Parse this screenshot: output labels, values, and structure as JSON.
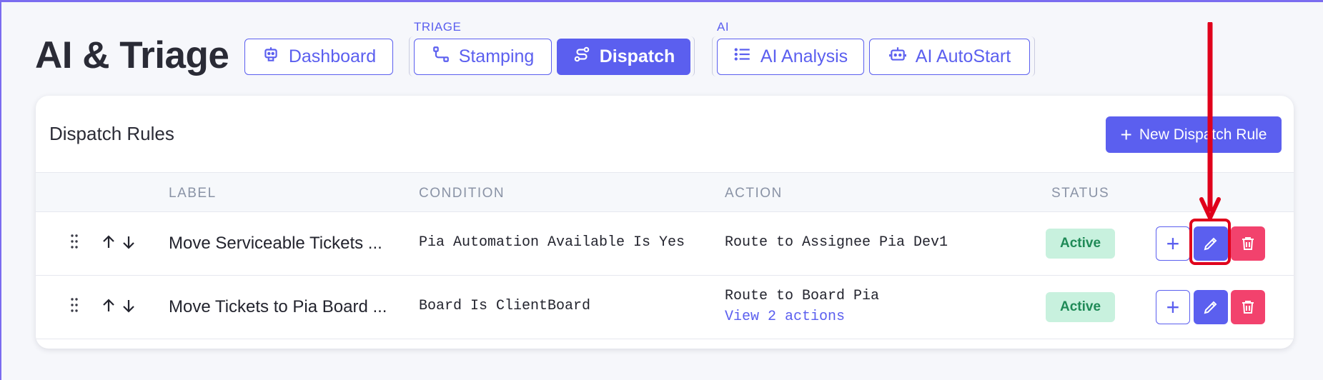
{
  "page": {
    "title": "AI & Triage"
  },
  "groups": {
    "triage_label": "TRIAGE",
    "ai_label": "AI"
  },
  "tabs": [
    {
      "label": "Dashboard",
      "icon": "robot-icon",
      "active": false
    },
    {
      "label": "Stamping",
      "icon": "route-icon",
      "active": false
    },
    {
      "label": "Dispatch",
      "icon": "dispatch-route-icon",
      "active": true
    },
    {
      "label": "AI Analysis",
      "icon": "list-icon",
      "active": false
    },
    {
      "label": "AI AutoStart",
      "icon": "robot-icon",
      "active": false
    }
  ],
  "card": {
    "title": "Dispatch Rules",
    "new_button": "New Dispatch Rule"
  },
  "table": {
    "headers": {
      "label": "LABEL",
      "condition": "CONDITION",
      "action": "ACTION",
      "status": "STATUS"
    },
    "rows": [
      {
        "label": "Move Serviceable Tickets ...",
        "condition": "Pia Automation Available Is Yes",
        "action": "Route to Assignee Pia Dev1",
        "action_link": "",
        "status": "Active"
      },
      {
        "label": "Move Tickets to Pia Board ...",
        "condition": "Board Is ClientBoard",
        "action": "Route to Board Pia",
        "action_link": "View 2 actions",
        "status": "Active"
      }
    ]
  },
  "colors": {
    "accent": "#5b5fef",
    "status_bg": "#c8f1de",
    "status_text": "#1f8a57",
    "delete": "#f2426d",
    "annotation": "#e0001b"
  }
}
